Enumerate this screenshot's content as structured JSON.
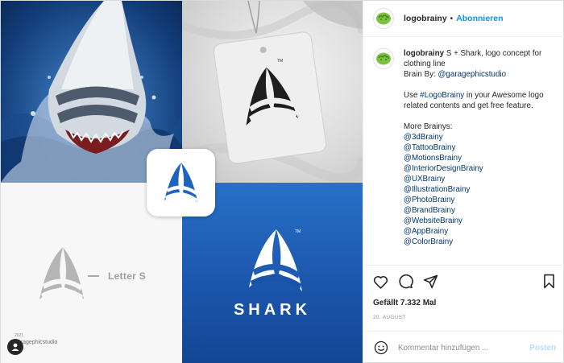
{
  "header": {
    "username": "logobrainy",
    "separator": "•",
    "follow_label": "Abonnieren"
  },
  "collage": {
    "letter_label": "Letter S",
    "brand_word": "SHARK",
    "trademark": "TM",
    "credit_year": "2021",
    "credit_name": "garagephicstudio"
  },
  "caption": {
    "username": "logobrainy",
    "text_1": "S + Shark, logo concept for clothing line",
    "brain_by_prefix": "Brain By: ",
    "brain_by_handle": "@garagephicstudio",
    "use_prefix": "Use ",
    "use_hashtag": "#LogoBrainy",
    "use_text": " in your Awesome logo related contents and get free feature.",
    "more_heading": "More Brainys:",
    "handles": [
      "@3dBrainy",
      "@TattooBrainy",
      "@MotionsBrainy",
      "@InteriorDesignBrainy",
      "@UXBrainy",
      "@IllustrationBrainy",
      "@PhotoBrainy",
      "@BrandBrainy",
      "@WebsiteBrainy",
      "@AppBrainy",
      "@ColorBrainy"
    ]
  },
  "actions": {
    "like_icon": "heart-icon",
    "comment_icon": "comment-icon",
    "share_icon": "paper-plane-icon",
    "save_icon": "bookmark-icon"
  },
  "stats": {
    "likes_text": "Gefällt 7.332 Mal",
    "date_text": "20. AUGUST"
  },
  "comment_box": {
    "placeholder": "Kommentar hinzufügen ...",
    "post_label": "Posten",
    "emoji_icon": "smiley-icon"
  },
  "colors": {
    "accent": "#0095f6",
    "link": "#00376b",
    "brand_blue": "#1e5bb2",
    "avatar_green": "#7cc243"
  }
}
